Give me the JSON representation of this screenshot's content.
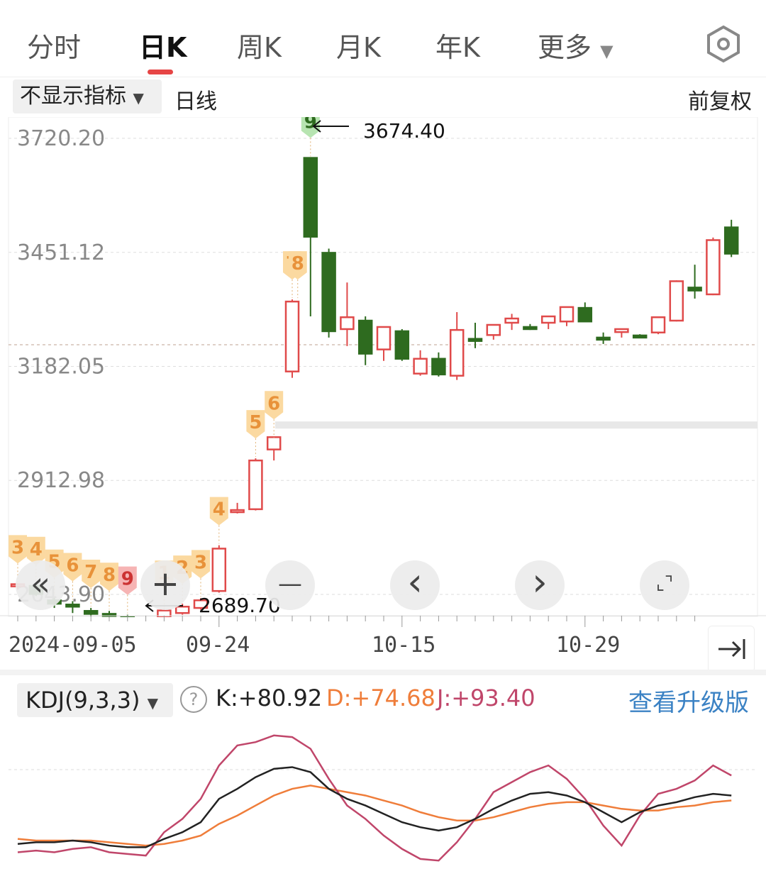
{
  "tabs": [
    {
      "label": "分时",
      "active": false
    },
    {
      "label": "日K",
      "active": true
    },
    {
      "label": "周K",
      "active": false
    },
    {
      "label": "月K",
      "active": false
    },
    {
      "label": "年K",
      "active": false
    },
    {
      "label": "更多",
      "active": false,
      "has_caret": true
    }
  ],
  "settings_icon": "hexagon-gear-icon",
  "indicator_dropdown": "不显示指标",
  "period_label": "日线",
  "adjust_label": "前复权",
  "accent_colors": {
    "up": "#e04a4a",
    "down": "#2e6b1f",
    "tab_underline": "#e64545",
    "k_line": "#222222",
    "d_line": "#ef7d3a",
    "j_line": "#c0466a",
    "upgrade_link": "#3b82c4"
  },
  "chart_data": {
    "type": "candlestick",
    "y_ticks": [
      "3720.20",
      "3451.12",
      "3182.05",
      "2912.98",
      "2643.90"
    ],
    "ylim": [
      2643.9,
      3720.2
    ],
    "high_annotation": "3674.40",
    "low_annotation": "2689.70",
    "x_labels": [
      "2024-09-05",
      "09-24",
      "10-15",
      "10-29"
    ],
    "candles": [
      {
        "o": 2665,
        "h": 2670,
        "l": 2655,
        "c": 2668
      },
      {
        "o": 2664,
        "h": 2666,
        "l": 2640,
        "c": 2645
      },
      {
        "o": 2630,
        "h": 2636,
        "l": 2612,
        "c": 2622
      },
      {
        "o": 2620,
        "h": 2628,
        "l": 2600,
        "c": 2618
      },
      {
        "o": 2605,
        "h": 2612,
        "l": 2592,
        "c": 2598
      },
      {
        "o": 2598,
        "h": 2605,
        "l": 2590,
        "c": 2596
      },
      {
        "o": 2590,
        "h": 2596,
        "l": 2580,
        "c": 2584
      },
      {
        "o": 2576,
        "h": 2586,
        "l": 2566,
        "c": 2583
      },
      {
        "o": 2590,
        "h": 2610,
        "l": 2585,
        "c": 2606
      },
      {
        "o": 2600,
        "h": 2622,
        "l": 2596,
        "c": 2615
      },
      {
        "o": 2612,
        "h": 2635,
        "l": 2608,
        "c": 2630
      },
      {
        "o": 2652,
        "h": 2760,
        "l": 2648,
        "c": 2752
      },
      {
        "o": 2840,
        "h": 2860,
        "l": 2835,
        "c": 2843
      },
      {
        "o": 2845,
        "h": 2965,
        "l": 2842,
        "c": 2960
      },
      {
        "o": 2986,
        "h": 3010,
        "l": 2960,
        "c": 3015
      },
      {
        "o": 3170,
        "h": 3340,
        "l": 3155,
        "c": 3335
      },
      {
        "o": 3674,
        "h": 3674.4,
        "l": 3300,
        "c": 3488
      },
      {
        "o": 3450,
        "h": 3460,
        "l": 3250,
        "c": 3265
      },
      {
        "o": 3270,
        "h": 3380,
        "l": 3230,
        "c": 3298
      },
      {
        "o": 3290,
        "h": 3300,
        "l": 3185,
        "c": 3212
      },
      {
        "o": 3222,
        "h": 3275,
        "l": 3195,
        "c": 3275
      },
      {
        "o": 3265,
        "h": 3270,
        "l": 3195,
        "c": 3200
      },
      {
        "o": 3165,
        "h": 3220,
        "l": 3160,
        "c": 3200
      },
      {
        "o": 3200,
        "h": 3215,
        "l": 3158,
        "c": 3163
      },
      {
        "o": 3160,
        "h": 3310,
        "l": 3150,
        "c": 3268
      },
      {
        "o": 3247,
        "h": 3285,
        "l": 3225,
        "c": 3243
      },
      {
        "o": 3256,
        "h": 3276,
        "l": 3245,
        "c": 3280
      },
      {
        "o": 3285,
        "h": 3306,
        "l": 3268,
        "c": 3295
      },
      {
        "o": 3275,
        "h": 3282,
        "l": 3268,
        "c": 3272
      },
      {
        "o": 3285,
        "h": 3300,
        "l": 3270,
        "c": 3300
      },
      {
        "o": 3288,
        "h": 3308,
        "l": 3277,
        "c": 3322
      },
      {
        "o": 3320,
        "h": 3333,
        "l": 3290,
        "c": 3288
      },
      {
        "o": 3250,
        "h": 3262,
        "l": 3235,
        "c": 3248
      },
      {
        "o": 3263,
        "h": 3270,
        "l": 3250,
        "c": 3270
      },
      {
        "o": 3255,
        "h": 3258,
        "l": 3250,
        "c": 3254
      },
      {
        "o": 3262,
        "h": 3300,
        "l": 3258,
        "c": 3298
      },
      {
        "o": 3290,
        "h": 3385,
        "l": 3288,
        "c": 3383
      },
      {
        "o": 3368,
        "h": 3422,
        "l": 3342,
        "c": 3361
      },
      {
        "o": 3352,
        "h": 3486,
        "l": 3350,
        "c": 3480
      },
      {
        "o": 3510,
        "h": 3528,
        "l": 3440,
        "c": 3448
      }
    ],
    "td_markers": [
      {
        "i": 0,
        "text": "3",
        "color": "orange"
      },
      {
        "i": 1,
        "text": "4",
        "color": "orange"
      },
      {
        "i": 2,
        "text": "5",
        "color": "orange"
      },
      {
        "i": 3,
        "text": "6",
        "color": "orange"
      },
      {
        "i": 4,
        "text": "7",
        "color": "orange"
      },
      {
        "i": 5,
        "text": "8",
        "color": "orange"
      },
      {
        "i": 6,
        "text": "9",
        "color": "red"
      },
      {
        "i": 8,
        "text": "1",
        "color": "orange"
      },
      {
        "i": 9,
        "text": "2",
        "color": "orange"
      },
      {
        "i": 10,
        "text": "3",
        "color": "orange"
      },
      {
        "i": 11,
        "text": "4",
        "color": "orange"
      },
      {
        "i": 13,
        "text": "5",
        "color": "orange"
      },
      {
        "i": 14,
        "text": "6",
        "color": "orange"
      },
      {
        "i": 15,
        "text": "7",
        "color": "orange"
      },
      {
        "i": 15.3,
        "text": "8",
        "color": "orange"
      },
      {
        "i": 16,
        "text": "9",
        "color": "green"
      }
    ]
  },
  "nav_buttons": [
    {
      "icon": "double-left-icon",
      "glyph": "«"
    },
    {
      "icon": "zoom-in-icon",
      "glyph": "+"
    },
    {
      "icon": "zoom-out-icon",
      "glyph": "—"
    },
    {
      "icon": "prev-icon",
      "glyph": "‹"
    },
    {
      "icon": "next-icon",
      "glyph": "›"
    },
    {
      "icon": "fullscreen-icon",
      "glyph": "⌞⌝"
    }
  ],
  "kdj": {
    "dropdown": "KDJ(9,3,3)",
    "k_label": "K:+80.92",
    "d_label": "D:+74.68",
    "j_label": "J:+93.40",
    "upgrade": "查看升级版",
    "k": [
      15,
      16,
      16,
      17,
      16,
      14,
      13,
      13,
      18,
      22,
      28,
      42,
      48,
      55,
      60,
      61,
      58,
      48,
      42,
      38,
      33,
      28,
      25,
      23,
      25,
      30,
      36,
      41,
      45,
      46,
      44,
      40,
      34,
      28,
      34,
      38,
      40,
      43,
      45,
      44
    ],
    "d": [
      18,
      17,
      17,
      17,
      17,
      16,
      15,
      14,
      15,
      17,
      20,
      27,
      32,
      38,
      44,
      48,
      50,
      48,
      46,
      44,
      41,
      38,
      34,
      31,
      29,
      29,
      31,
      34,
      37,
      39,
      40,
      40,
      38,
      36,
      35,
      35,
      37,
      38,
      40,
      41
    ],
    "j": [
      10,
      11,
      10,
      12,
      13,
      10,
      9,
      8,
      22,
      30,
      42,
      62,
      74,
      76,
      80,
      79,
      72,
      54,
      38,
      30,
      20,
      12,
      6,
      5,
      16,
      30,
      46,
      52,
      58,
      62,
      54,
      42,
      26,
      14,
      32,
      45,
      48,
      53,
      62,
      56
    ]
  }
}
